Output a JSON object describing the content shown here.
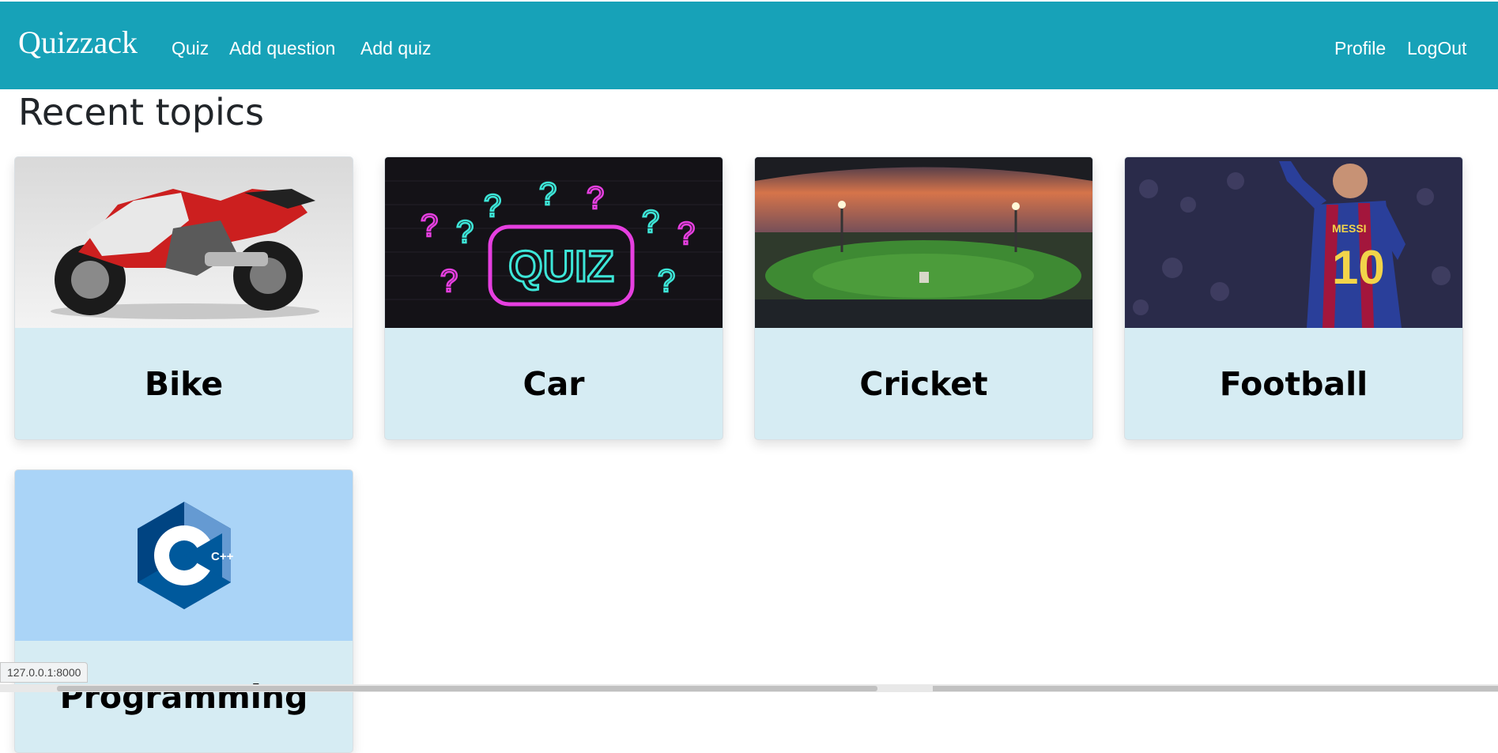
{
  "navbar": {
    "brand": "Quizzack",
    "links_left": [
      "Quiz",
      "Add question",
      "Add quiz"
    ],
    "links_right": [
      "Profile",
      "LogOut"
    ],
    "background": "#17a2b8"
  },
  "heading": "Recent topics",
  "topics": [
    {
      "title": "Bike",
      "image": "motorcycle-photo"
    },
    {
      "title": "Car",
      "image": "neon-quiz-sign"
    },
    {
      "title": "Cricket",
      "image": "cricket-stadium-sunset"
    },
    {
      "title": "Football",
      "image": "football-player-photo"
    },
    {
      "title": "Programming",
      "image": "cplusplus-logo"
    }
  ],
  "cpp_logo_text": "C++",
  "status_bar": {
    "url": "127.0.0.1:8000"
  },
  "colors": {
    "card_body": "#d6ecf3",
    "accent": "#17a2b8"
  }
}
